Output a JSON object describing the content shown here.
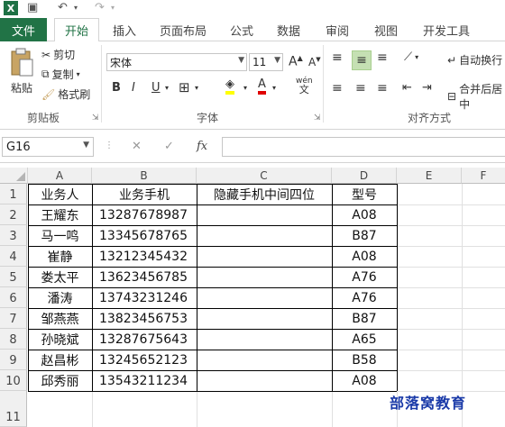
{
  "qat": {
    "logo": "X",
    "undo": "↶",
    "redo": "↷"
  },
  "tabs": {
    "file": "文件",
    "items": [
      "开始",
      "插入",
      "页面布局",
      "公式",
      "数据",
      "审阅",
      "视图",
      "开发工具"
    ],
    "active": "开始"
  },
  "ribbon": {
    "clipboard": {
      "paste": "粘贴",
      "cut": "剪切",
      "copy": "复制",
      "format_painter": "格式刷",
      "label": "剪贴板"
    },
    "font": {
      "name": "宋体",
      "size": "11",
      "bold": "B",
      "italic": "I",
      "underline": "U",
      "label": "字体",
      "wen": "wén\n文"
    },
    "alignment": {
      "wrap": "自动换行",
      "merge": "合并后居中",
      "label": "对齐方式"
    }
  },
  "formula_bar": {
    "name_box": "G16",
    "fx": "fx",
    "value": ""
  },
  "columns": [
    "A",
    "B",
    "C",
    "D",
    "E",
    "F"
  ],
  "rows": [
    "1",
    "2",
    "3",
    "4",
    "5",
    "6",
    "7",
    "8",
    "9",
    "10",
    "11"
  ],
  "table": {
    "headers": [
      "业务人",
      "业务手机",
      "隐藏手机中间四位",
      "型号"
    ],
    "data": [
      [
        "王耀东",
        "13287678987",
        "",
        "A08"
      ],
      [
        "马一鸣",
        "13345678765",
        "",
        "B87"
      ],
      [
        "崔静",
        "13212345432",
        "",
        "A08"
      ],
      [
        "娄太平",
        "13623456785",
        "",
        "A76"
      ],
      [
        "潘涛",
        "13743231246",
        "",
        "A76"
      ],
      [
        "邹燕燕",
        "13823456753",
        "",
        "B87"
      ],
      [
        "孙晓斌",
        "13287675643",
        "",
        "A65"
      ],
      [
        "赵昌彬",
        "13245652123",
        "",
        "B58"
      ],
      [
        "邱秀丽",
        "13543211234",
        "",
        "A08"
      ]
    ]
  },
  "watermark": "部落窝教育"
}
